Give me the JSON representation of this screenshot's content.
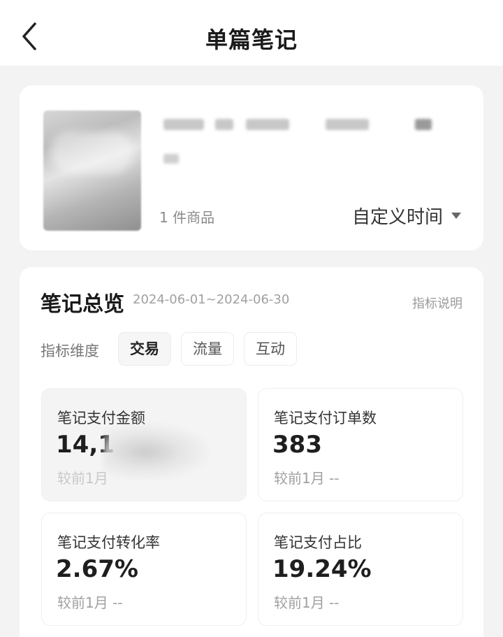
{
  "nav": {
    "title": "单篇笔记"
  },
  "note": {
    "goods_count": "1 件商品",
    "time_select": "自定义时间"
  },
  "overview": {
    "title": "笔记总览",
    "date_range": "2024-06-01~2024-06-30",
    "help": "指标说明",
    "dimension_label": "指标维度",
    "tabs": [
      {
        "label": "交易",
        "active": true
      },
      {
        "label": "流量",
        "active": false
      },
      {
        "label": "互动",
        "active": false
      }
    ],
    "metrics": [
      {
        "label": "笔记支付金额",
        "value": "14,1",
        "compare": "较前1月"
      },
      {
        "label": "笔记支付订单数",
        "value": "383",
        "compare": "较前1月 --"
      },
      {
        "label": "笔记支付转化率",
        "value": "2.67%",
        "compare": "较前1月 --"
      },
      {
        "label": "笔记支付占比",
        "value": "19.24%",
        "compare": "较前1月 --"
      }
    ]
  }
}
